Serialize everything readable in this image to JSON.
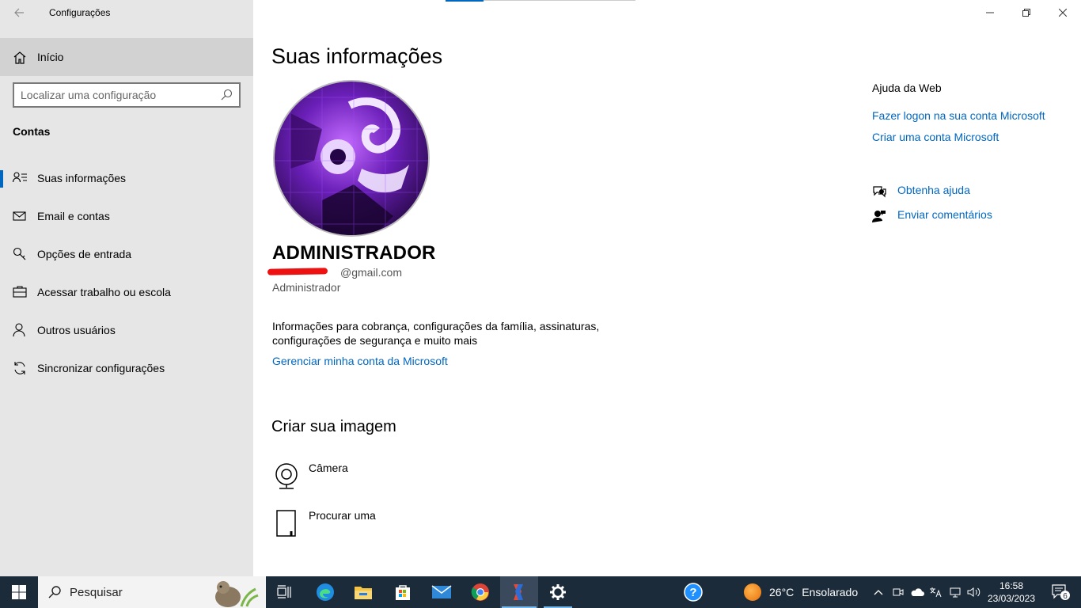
{
  "window": {
    "title": "Configurações"
  },
  "sidebar": {
    "home_label": "Início",
    "search_placeholder": "Localizar uma configuração",
    "section_title": "Contas",
    "items": [
      {
        "label": "Suas informações",
        "icon": "person-list-icon",
        "active": true
      },
      {
        "label": "Email e contas",
        "icon": "mail-icon"
      },
      {
        "label": "Opções de entrada",
        "icon": "key-icon"
      },
      {
        "label": "Acessar trabalho ou escola",
        "icon": "briefcase-icon"
      },
      {
        "label": "Outros usuários",
        "icon": "person-icon"
      },
      {
        "label": "Sincronizar configurações",
        "icon": "sync-icon"
      }
    ]
  },
  "main": {
    "title": "Suas informações",
    "user": {
      "name": "ADMINISTRADOR",
      "email": "@gmail.com",
      "role": "Administrador"
    },
    "info_text": "Informações para cobrança, configurações da família, assinaturas, configurações de segurança e muito mais",
    "manage_link": "Gerenciar minha conta da Microsoft",
    "create_title": "Criar sua imagem",
    "options": [
      {
        "label": "Câmera",
        "icon": "camera-icon"
      },
      {
        "label": "Procurar uma",
        "icon": "browse-file-icon"
      }
    ]
  },
  "help": {
    "title": "Ajuda da Web",
    "links": [
      "Fazer logon na sua conta Microsoft",
      "Criar uma conta Microsoft"
    ],
    "get_help": "Obtenha ajuda",
    "feedback": "Enviar comentários"
  },
  "taskbar": {
    "search_placeholder": "Pesquisar",
    "weather_temp": "26°C",
    "weather_desc": "Ensolarado",
    "time": "16:58",
    "date": "23/03/2023",
    "notification_count": "6"
  },
  "colors": {
    "accent": "#0067c0",
    "sidebar_bg": "#e6e6e6",
    "taskbar_bg": "#1c2b3a"
  }
}
